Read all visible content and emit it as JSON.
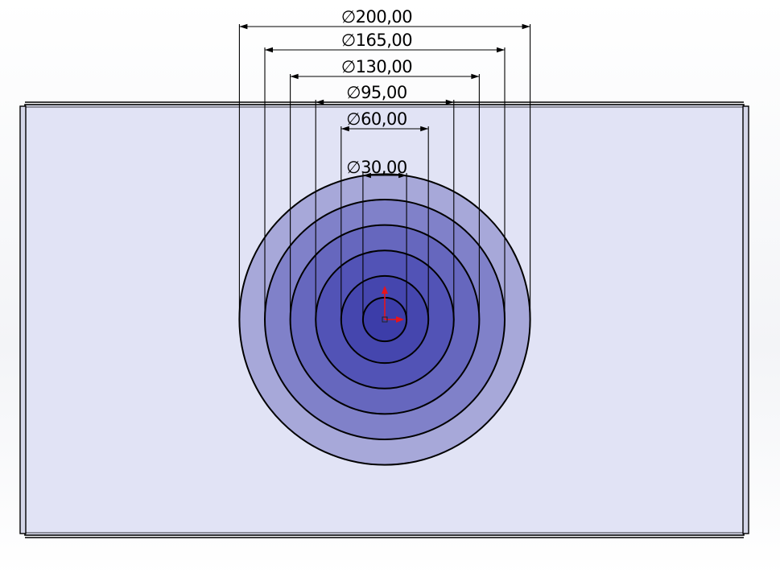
{
  "viewport": {
    "background_color": "#f2f3f6",
    "plate_color": "#e1e3f5",
    "plate_edge_color": "#000000"
  },
  "part": {
    "description": "concentric stepped circular features on plate",
    "fill_colors": [
      "#a7a8d9",
      "#8081c9",
      "#6667be",
      "#5253b6",
      "#4546ae",
      "#3c3da9"
    ]
  },
  "dimensions": [
    {
      "symbol": "∅",
      "value": "200,00",
      "diameter": 200
    },
    {
      "symbol": "∅",
      "value": "165,00",
      "diameter": 165
    },
    {
      "symbol": "∅",
      "value": "130,00",
      "diameter": 130
    },
    {
      "symbol": "∅",
      "value": "95,00",
      "diameter": 95
    },
    {
      "symbol": "∅",
      "value": "60,00",
      "diameter": 60
    },
    {
      "symbol": "∅",
      "value": "30,00",
      "diameter": 30
    }
  ],
  "origin_triad": {
    "icon": "origin-triad-icon",
    "color": "#e8141b"
  }
}
